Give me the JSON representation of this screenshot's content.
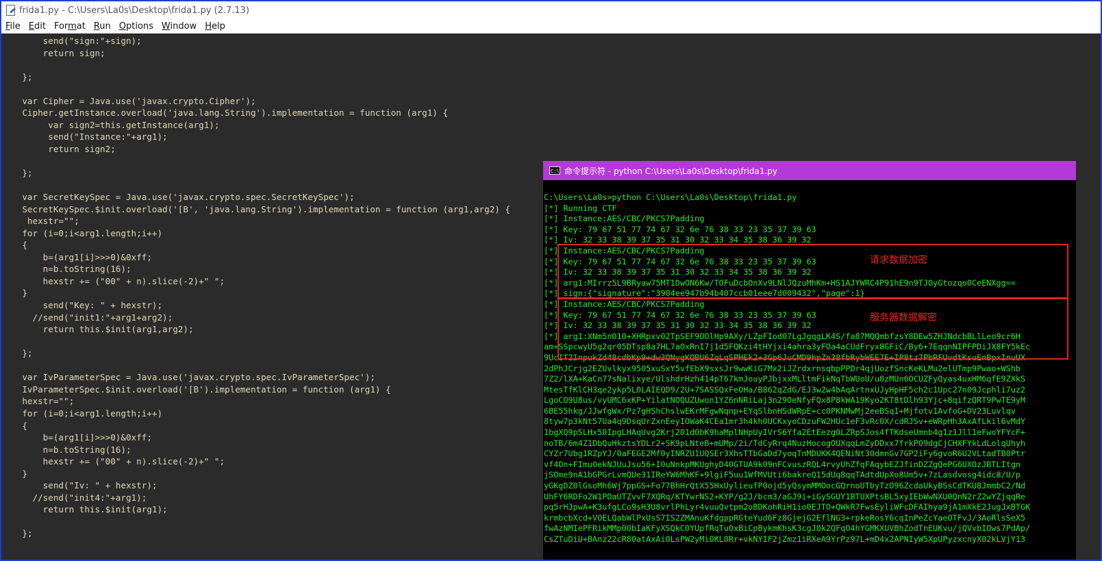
{
  "window": {
    "title": "frida1.py - C:\\Users\\La0s\\Desktop\\frida1.py (2.7.13)"
  },
  "menu": [
    {
      "mnemonic": "F",
      "rest": "ile"
    },
    {
      "mnemonic": "E",
      "rest": "dit"
    },
    {
      "mnemonic": "",
      "rest": "F",
      "extra": ""
    },
    {
      "mnemonic": "R",
      "rest": "un"
    },
    {
      "mnemonic": "O",
      "rest": "ptions"
    },
    {
      "mnemonic": "W",
      "rest": "indow"
    },
    {
      "mnemonic": "H",
      "rest": "elp"
    }
  ],
  "menu_labels": [
    "File",
    "Edit",
    "Format",
    "Run",
    "Options",
    "Window",
    "Help"
  ],
  "code": "        send(\"sign:\"+sign);\n        return sign;\n\n    };\n\n    var Cipher = Java.use('javax.crypto.Cipher');\n    Cipher.getInstance.overload('java.lang.String').implementation = function (arg1) {\n         var sign2=this.getInstance(arg1);\n         send(\"Instance:\"+arg1);\n         return sign2;\n\n    };\n\n    var SecretKeySpec = Java.use('javax.crypto.spec.SecretKeySpec');\n    SecretKeySpec.$init.overload('[B', 'java.lang.String').implementation = function (arg1,arg2) {\n     hexstr=\"\";\n    for (i=0;i<arg1.length;i++)\n    {\n        b=(arg1[i]>>>0)&0xff;\n        n=b.toString(16);\n        hexstr += (\"00\" + n).slice(-2)+\" \";\n    }\n        send(\"Key: \" + hexstr);\n      //send(\"init1:\"+arg1+arg2);\n        return this.$init(arg1,arg2);\n\n    };\n\n    var IvParameterSpec = Java.use('javax.crypto.spec.IvParameterSpec');\n    IvParameterSpec.$init.overload('[B').implementation = function (arg1) {\n    hexstr=\"\";\n    for (i=0;i<arg1.length;i++)\n    {\n        b=(arg1[i]>>>0)&0xff;\n        n=b.toString(16);\n        hexstr += (\"00\" + n).slice(-2)+\" \";\n    }\n        send(\"Iv: \" + hexstr);\n      //send(\"init4:\"+arg1);\n        return this.$init(arg1);\n\n    };",
  "cmd": {
    "title": "命令提示符 - python  C:\\Users\\La0s\\Desktop\\frida1.py",
    "output": "C:\\Users\\La0s>python C:\\Users\\La0s\\Desktop\\frida1.py\n[*] Running CTF\n[*] Instance:AES/CBC/PKCS7Padding\n[*] Key: 79 67 51 77 74 67 32 6e 76 38 33 23 35 37 39 63\n[*] Iv: 32 33 38 39 37 35 31 30 32 33 34 35 38 36 39 32\n[*] Instance:AES/CBC/PKCS7Padding\n[*] Key: 79 67 51 77 74 67 32 6e 76 38 33 23 35 37 39 63\n[*] Iv: 32 33 38 39 37 35 31 30 32 33 34 35 38 36 39 32\n[*] arg1:MIrrz5L9BRyaw75MT1DwON6Kw/TOFuDcbOnXv9LNlJQzuMhKm+HS1AJYWRC4P91hE9n9TJOyGtozqo0CeENXgg==\n[*] sign:{\"signature\":\"3904ee947b94b407ccb01eee7d009432\",\"page\":1}\n[*] Instance:AES/CBC/PKCS7Padding\n[*] Key: 79 67 51 77 74 67 32 6e 76 38 33 23 35 37 39 63\n[*] Iv: 32 33 38 39 37 35 31 30 32 33 34 35 38 36 39 32\n[*] arg1:XNm5n010+XHRpxv02TpSEF9OOlHp9AXy/LZpFIod07LgJgqgLK4S/fa87MQQmbfzsY8DEw5ZHJNdcbBLlLeo9cr6H\nam+SSpcwyU5g2qr05DTsp8a7HL7aOxRnI7j1d5FQKzi4tHYjxi4ahra3yFOa4aCUdFryx8GFiC/By6+7EqqnNIPFPDiJX8FY5kEc\n9UcIT2InpukZd48cdbKp9+dw3QNygKQBU6ZqLqSPHEk2+3Gp6JuCMD9hpZn38fbRybWEE7E+IP8tz7PbRFUvdtKsuEnBpxInuUX\n2dPhJCrjg2EZUvlkyx9505xuSxY5vfEbX9sxsJr9wwKiG7Mx2iJZrdxrnsqbpPPDr4qjUozfSncKeKLMu2elUTmp9Pwao+WShb\n7Z2/lXA+KaCn77sNalixye/UlshdrHzh414pT67kmJouyPJbjxxMLltmFikNqTbWUoU/u0zMUn6OCUZFyQyas4uxHM6qfE9ZXkS\nMtesTfKlCH3qe2ykp5L0LAIEQD9/2U+7SASSQxFeOHa/B862qZdG/EJ3w2w4bAqArtnxUJyHpHF5ch2c1Upc27n09Jcphli7uz2\nLgoCO9U8us/vyUMC6xKP+YilatNOQUZUwon1YZ6nNRiLaj3n29OeNfyFQx8P8kWA19Kyo2KT8tDlh93Yjc+8qifzQRT9PwTE9yM\n6BE55hkg/JJwfgWx/Pz7gHShChslwEKrMFgwNqnp+EYqSlbnHSdWRpE+cc0PKNMwMj2eeBSqI+Mjfotv1AvfoG+DV23Luvlqv\n8tyw7p3kNt57Ua4q9DsqUrZxnEeyIOWaK4CEa1mr3h4kh0UCKxyoCDzuFW2HUc1eF3vRc0X/cdRJSv+eWRpHh3AxAfLkil6vMdY\n1bgXQ9pSLHx50IpgLHAqUvg2Krj201d0bK9haMplNHpUyIVrS6Yfa2EtEezg0LZRpSJos4fTKdseUmnb4g1z1Jll1eFwoYFYcF+\nnoTB/6m4Z1DbQuHkztsYDLr2+SK9pLNteB+mUMp/2i/TdCyRrq4NuzHocogOUXqqLmZyDDxx7frkP09dgCjCHXFYkLdLolqUhyh\nCYZr7Ubg1RZpYJ/0aFEGE2Mf0yINRZU1UQSEr3XhsTTbGaDd7yoqTnMDUKK4QENiNt30dmnGv7GP2iFy6gvoR6U2VLtadTB0Ptr\nvf4On+FImu0ekNJUuJsu56+I0uNnkpMKUghyD40GTUA9k09nFCvuszRQL4rvyUhZfqFAqybEZJfinDZZgQePG6UXOzJBTLItgn\njSOme9nA1bGPGrLvmQUe31IReYW6MhKF+9lgiF5uu1WfMVUti6bakreQ15dUq8qqTAdtdUpXo8Um5v+7zLasdvosg4idc8/U/p\nyGKgDZ0lGsoMh6Wj7ppGS+Fo77BhHrQtX55HxUylieufP0ojd5yQsymMMOocGQrnoUTbyTzO96ZcdaUkyBSsCdTKU8JmmbC2/Nd\nUhFY6RDFo2W1PDaUTZvvF7XQRq/KTYwrNS2+KYP/g2J/bcm3/aGJ9i+iGySGUY1BTUXPtsBL5xyIEbWwNXU0QnN2rZ2wYZjqqRe\npq5rHJpwA+K3ufgLCo9sH3U8vrlPhLyr4vuuQvtpm2oBDKohRiH1io0EJTO+QWkR7FwsEyliWFcDFAIhya9jA1mXkE2JugJxBTGK\nkrmbcbXcd+VOELQabWlPxUsS7IS2ZMAnuKfdgppRGteYud6Fz8GjejG2EflNG3+rpkeRosY6cqInPeZcYaeOTFvJ/3AoRlsSeX5\nfwAzNMIePFRikMMp00bIaKFyXSQkC0YUpfRqTu0xBiCpBykmKhsK3cgJ0k2QFqO4hYGMKXUVBhZodTnEUKvu/jQVvbIOws7PdAp/\nCsZTuDiU+BAnz22cR80atAxAi0LsPW2yMi0KL0Rr+vkNYIF2jZmz1iRXeA9YrPz97L+mD4x2APNIyW5XpUPyzxcnyX02kLVjY13",
    "annotations": {
      "encrypt_label": "请求数据加密",
      "decrypt_label": "服务器数据解密"
    }
  }
}
